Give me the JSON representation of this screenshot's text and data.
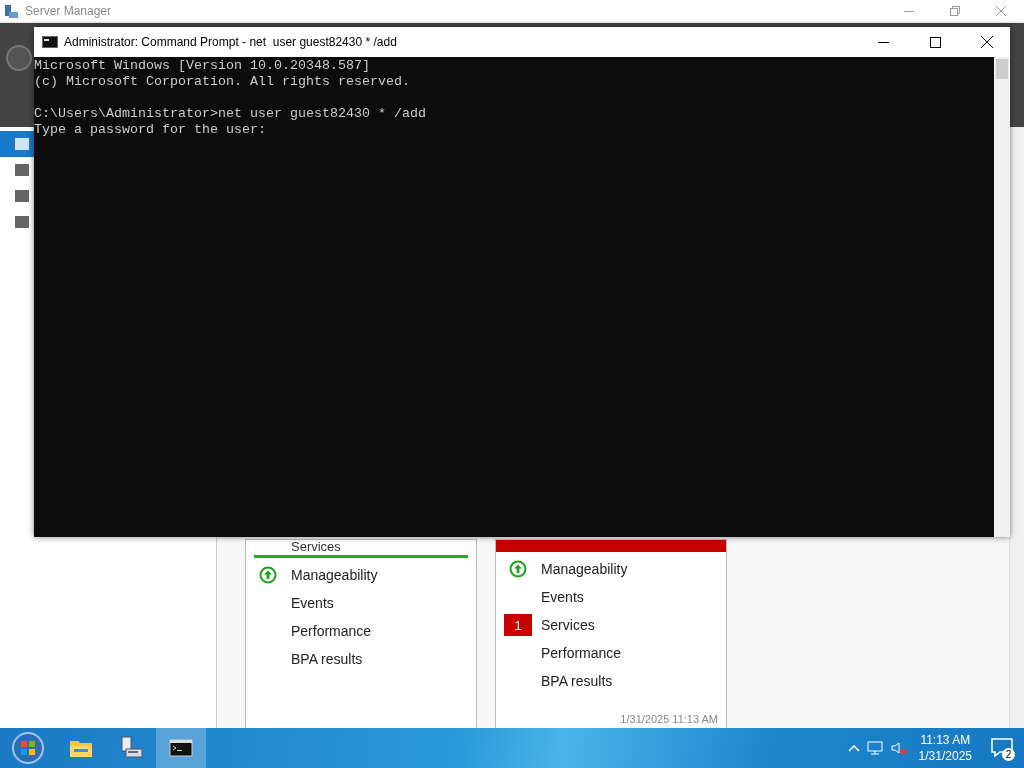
{
  "server_manager": {
    "title": "Server Manager",
    "nav_items": [
      {
        "selected": true
      },
      {
        "selected": false
      },
      {
        "selected": false
      },
      {
        "selected": false
      }
    ],
    "tiles": [
      {
        "title": "Services",
        "alert": false,
        "rows": [
          {
            "label": "Manageability",
            "up": true
          },
          {
            "label": "Events",
            "up": false
          },
          {
            "label": "Performance",
            "up": false
          },
          {
            "label": "BPA results",
            "up": false
          }
        ]
      },
      {
        "alert": true,
        "rows": [
          {
            "label": "Manageability",
            "up": true
          },
          {
            "label": "Events",
            "up": false
          },
          {
            "label": "Services",
            "count": "1"
          },
          {
            "label": "Performance",
            "up": false
          },
          {
            "label": "BPA results",
            "up": false
          }
        ],
        "timestamp": "1/31/2025 11:13 AM"
      }
    ]
  },
  "command_prompt": {
    "title": "Administrator: Command Prompt - net  user guest82430 * /add",
    "blocks": [
      [
        "Microsoft Windows [Version 10.0.20348.587]",
        "(c) Microsoft Corporation. All rights reserved."
      ],
      [
        "C:\\Users\\Administrator>net user guest82430 * /add",
        "Type a password for the user:"
      ]
    ]
  },
  "taskbar": {
    "apps": [
      {
        "kind": "explorer",
        "active": false
      },
      {
        "kind": "server",
        "active": false
      },
      {
        "kind": "console",
        "active": true
      }
    ],
    "time": "11:13 AM",
    "date": "1/31/2025",
    "notifications": "2"
  }
}
